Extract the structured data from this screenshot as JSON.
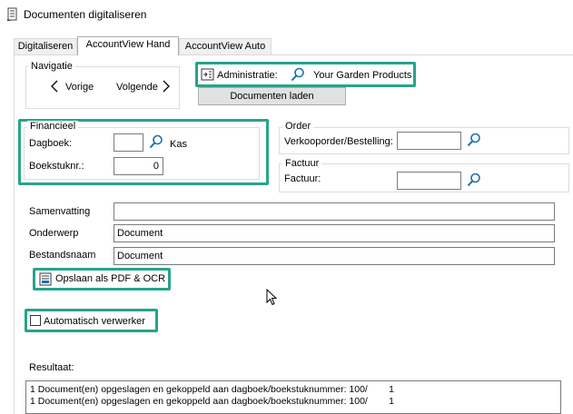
{
  "window": {
    "title": "Documenten digitaliseren"
  },
  "tabs": [
    "Digitaliseren",
    "AccountView Hand",
    "AccountView Auto"
  ],
  "navigatie": {
    "legend": "Navigatie",
    "prev_label": "Vorige",
    "next_label": "Volgende"
  },
  "administratie": {
    "label": "Administratie:",
    "value": "Your Garden Products",
    "load_button": "Documenten laden"
  },
  "financieel": {
    "legend": "Financieel",
    "dagboek_label": "Dagboek:",
    "dagboek_value": "",
    "dagboek_name": "Kas",
    "boekstuk_label": "Boekstuknr.:",
    "boekstuk_value": "0"
  },
  "order": {
    "legend": "Order",
    "label": "Verkooporder/Bestelling:",
    "value": ""
  },
  "factuur": {
    "legend": "Factuur",
    "label": "Factuur:",
    "value": ""
  },
  "fields": {
    "samenvatting_label": "Samenvatting",
    "samenvatting_value": "",
    "onderwerp_label": "Onderwerp",
    "onderwerp_value": "Document",
    "bestandsnaam_label": "Bestandsnaam",
    "bestandsnaam_value": "Document"
  },
  "save_button": "Opslaan als PDF & OCR",
  "auto": {
    "label": "Automatisch verwerker",
    "checked": false
  },
  "resultaat": {
    "label": "Resultaat:",
    "lines": [
      "1 Document(en) opgeslagen en gekoppeld aan dagboek/boekstuknummer: 100/        1",
      "1 Document(en) opgeslagen en gekoppeld aan dagboek/boekstuknummer: 100/        1"
    ]
  },
  "colors": {
    "highlight": "#27a488",
    "accent": "#1a6fb4"
  },
  "icons": [
    "app-icon",
    "chevron-left-icon",
    "chevron-right-icon",
    "admin-icon",
    "search-icon",
    "save-pdf-icon",
    "cursor-icon"
  ]
}
